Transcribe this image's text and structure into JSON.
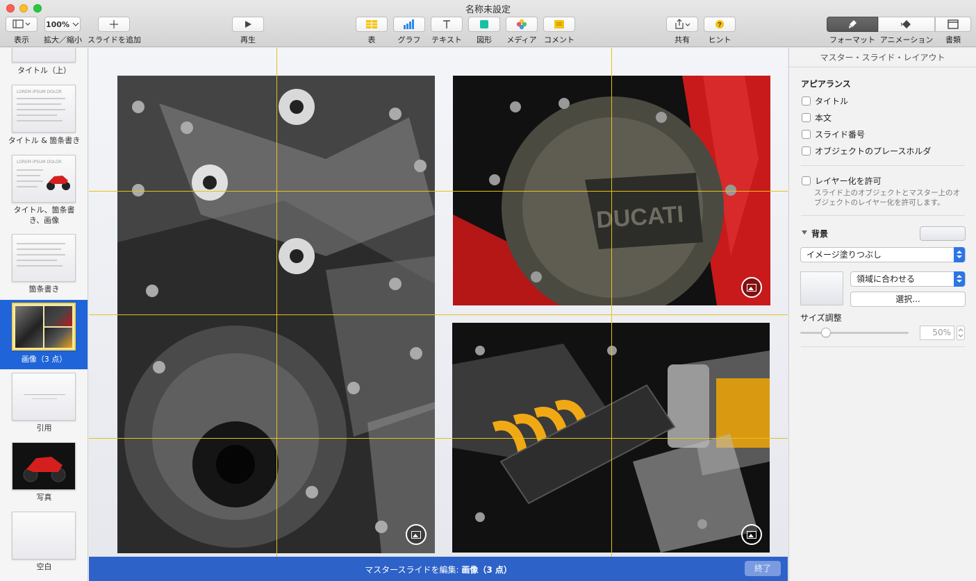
{
  "window": {
    "title": "名称未設定"
  },
  "toolbar": {
    "view": "表示",
    "zoom_value": "100%",
    "zoom": "拡大／縮小",
    "add_slide": "スライドを追加",
    "play": "再生",
    "table": "表",
    "chart": "グラフ",
    "text": "テキスト",
    "shape": "図形",
    "media": "メディア",
    "comment": "コメント",
    "share": "共有",
    "tips": "ヒント",
    "format": "フォーマット",
    "animate": "アニメーション",
    "document": "書類"
  },
  "navigator": {
    "slides": [
      {
        "label": "タイトル（上）"
      },
      {
        "label": "タイトル & 箇条書き",
        "title": "LOREM IPSUM DOLOR"
      },
      {
        "label": "タイトル、箇条書\nき、画像",
        "title": "LOREM IPSUM DOLOR"
      },
      {
        "label": "箇条書き"
      },
      {
        "label": "画像（3 点）"
      },
      {
        "label": "引用"
      },
      {
        "label": "写真"
      },
      {
        "label": "空白"
      }
    ]
  },
  "inspector": {
    "header": "マスター・スライド・レイアウト",
    "appearance": "アピアランス",
    "opt_title": "タイトル",
    "opt_body": "本文",
    "opt_slide_number": "スライド番号",
    "opt_placeholder": "オブジェクトのプレースホルダ",
    "allow_layering": "レイヤー化を許可",
    "layering_hint": "スライド上のオブジェクトとマスター上のオブジェクトのレイヤー化を許可します。",
    "background": "背景",
    "fill_type": "イメージ塗りつぶし",
    "scale_mode": "領域に合わせる",
    "choose": "選択...",
    "size_label": "サイズ調整",
    "size_value": "50%"
  },
  "editbar": {
    "prefix": "マスタースライドを編集:",
    "slide_name": "画像（3 点）",
    "done": "終了"
  },
  "colors": {
    "selection_blue": "#1f64d9",
    "guide_yellow": "#e6c21a",
    "editbar_blue": "#2d62c8"
  }
}
